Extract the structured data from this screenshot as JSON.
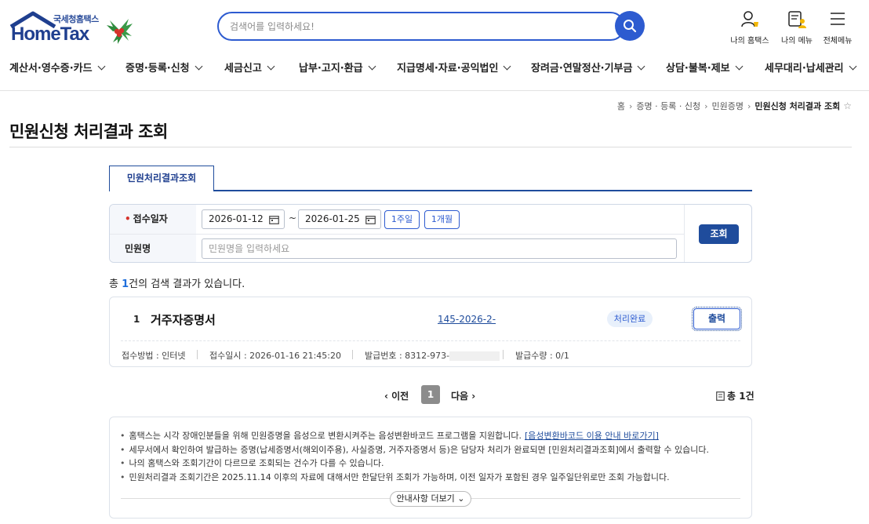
{
  "header": {
    "logo_sub": "국세청홈택스",
    "logo_main": "HomeTax",
    "search_placeholder": "검색어를 입력하세요!",
    "icons": [
      {
        "name": "my-hometax-icon",
        "label": "나의 홈택스"
      },
      {
        "name": "my-menu-icon",
        "label": "나의 메뉴"
      },
      {
        "name": "all-menu-icon",
        "label": "전체메뉴"
      }
    ]
  },
  "gnb": [
    "계산서·영수증·카드",
    "증명·등록·신청",
    "세금신고",
    "납부·고지·환급",
    "지급명세·자료·공익법인",
    "장려금·연말정산·기부금",
    "상담·불복·제보",
    "세무대리·납세관리"
  ],
  "breadcrumb": [
    "홈",
    "증명 · 등록 · 신청",
    "민원증명",
    "민원신청 처리결과 조회"
  ],
  "page_title": "민원신청 처리결과 조회",
  "tab_label": "민원처리결과조회",
  "form": {
    "date_label": "접수일자",
    "date_from": "2026-01-12",
    "date_to": "2026-01-25",
    "tilde": "~",
    "btn_1week": "1주일",
    "btn_1month": "1개월",
    "name_label": "민원명",
    "name_placeholder": "민원명을 입력하세요",
    "query_button": "조회"
  },
  "result": {
    "prefix": "총 ",
    "count": "1",
    "suffix": "건의 검색 결과가 있습니다."
  },
  "card": {
    "num": "1",
    "title": "거주자증명서",
    "app_no": "145-2026-2-",
    "status": "처리완료",
    "print": "출력",
    "method": "접수방법 : 인터넷",
    "received": "접수일시 : 2026-01-16 21:45:20",
    "issue_no": "발급번호 : 8312-973-",
    "issue_qty": "발급수량 : 0/1"
  },
  "pagination": {
    "prev": "이전",
    "current": "1",
    "next": "다음",
    "total_prefix": "총 ",
    "total_count": "1",
    "total_suffix": "건"
  },
  "notice": {
    "items": [
      "홈택스는 시각 장애인분들을 위해 민원증명을 음성으로 변환시켜주는 음성변환바코드 프로그램을 지원합니다.",
      "세무서에서 확인하여 발급하는 증명(납세증명서(해외이주용), 사실증명, 거주자증명서 등)은 담당자 처리가 완료되면 [민원처리결과조회]에서 출력할 수 있습니다.",
      "나의 홈택스와 조회기간이 다르므로 조회되는 건수가 다를 수 있습니다.",
      "민원처리결과 조회기간은 2025.11.14 이후의 자료에 대해서만 한달단위 조회가 가능하며, 이전 일자가 포함된 경우 일주일단위로만 조회 가능합니다."
    ],
    "link": "[음성변환바코드 이용 안내 바로가기]",
    "more": "안내사항 더보기"
  },
  "colors": {
    "primary": "#1f4c9c",
    "accent": "#2d5bd0",
    "required": "#d6322b"
  }
}
